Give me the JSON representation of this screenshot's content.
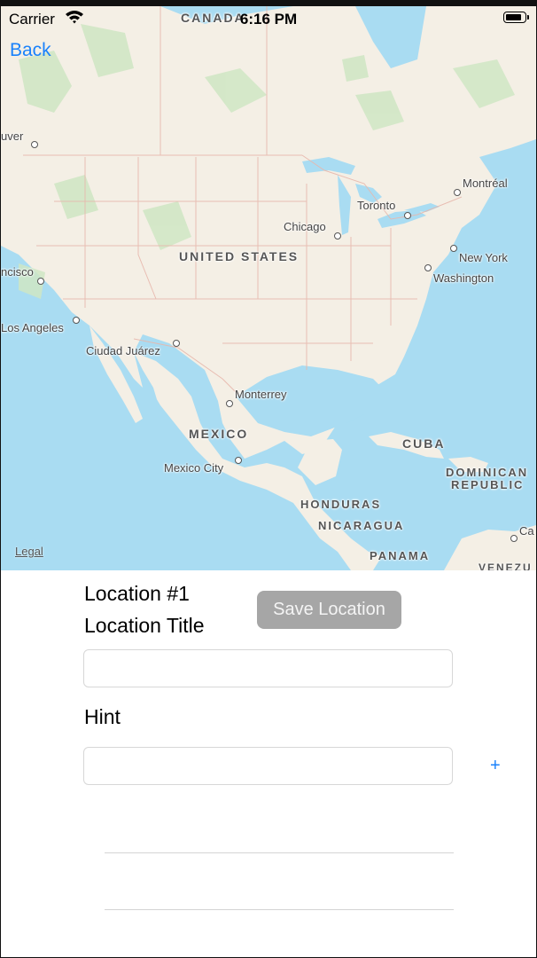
{
  "status_bar": {
    "carrier": "Carrier",
    "time": "6:16 PM"
  },
  "nav": {
    "back_label": "Back"
  },
  "map": {
    "legal": "Legal",
    "labels": {
      "canada": "CANADA",
      "vancouver": "uver",
      "montreal": "Montréal",
      "toronto": "Toronto",
      "chicago": "Chicago",
      "united_states": "UNITED STATES",
      "new_york": "New York",
      "washington": "Washington",
      "san_francisco": "ncisco",
      "los_angeles": "Los Angeles",
      "ciudad_juarez": "Ciudad Juárez",
      "monterrey": "Monterrey",
      "mexico": "MEXICO",
      "mexico_city": "Mexico City",
      "cuba": "CUBA",
      "dominican_republic_1": "DOMINICAN",
      "dominican_republic_2": "REPUBLIC",
      "honduras": "HONDURAS",
      "nicaragua": "NICARAGUA",
      "panama": "PANAMA",
      "venezuela": "VENEZU",
      "caracas": "Ca"
    },
    "colors": {
      "water": "#a9dcf2",
      "land": "#f4efe5",
      "vegetation": "#cfe6c4"
    }
  },
  "form": {
    "location_heading": "Location #1",
    "location_title_label": "Location Title",
    "save_button_label": "Save Location",
    "title_input_value": "",
    "hint_label": "Hint",
    "hint_input_value": "",
    "add_button_label": "+"
  },
  "colors": {
    "accent": "#1a82fb",
    "save_button_disabled": "#a6a6a6"
  }
}
